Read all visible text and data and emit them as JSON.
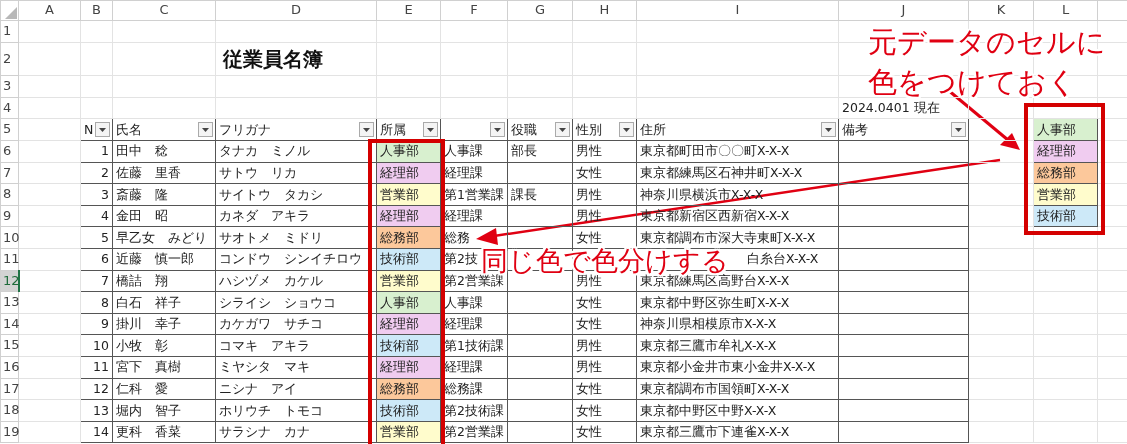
{
  "column_letters": [
    "A",
    "B",
    "C",
    "D",
    "E",
    "F",
    "G",
    "H",
    "I",
    "J",
    "K",
    "L"
  ],
  "row_headers": [
    {
      "label": "1",
      "selected": false
    },
    {
      "label": "2",
      "selected": false
    },
    {
      "label": "3",
      "selected": false
    },
    {
      "label": "4",
      "selected": false
    },
    {
      "label": "5",
      "selected": false
    },
    {
      "label": "6",
      "selected": false
    },
    {
      "label": "7",
      "selected": false
    },
    {
      "label": "8",
      "selected": false
    },
    {
      "label": "9",
      "selected": false
    },
    {
      "label": "10",
      "selected": false
    },
    {
      "label": "11",
      "selected": false
    },
    {
      "label": "12",
      "selected": true
    },
    {
      "label": "13",
      "selected": false
    },
    {
      "label": "14",
      "selected": false
    },
    {
      "label": "15",
      "selected": false
    },
    {
      "label": "16",
      "selected": false
    },
    {
      "label": "17",
      "selected": false
    },
    {
      "label": "18",
      "selected": false
    },
    {
      "label": "19",
      "selected": false
    }
  ],
  "title": "従業員名簿",
  "as_of": "2024.0401 現在",
  "table": {
    "columns": [
      {
        "label": "N"
      },
      {
        "label": "氏名"
      },
      {
        "label": "フリガナ"
      },
      {
        "label": "所属"
      },
      {},
      {
        "label": "役職"
      },
      {
        "label": "性別"
      },
      {
        "label": "住所"
      },
      {
        "label": "備考"
      }
    ],
    "rows": [
      {
        "no": "1",
        "name": "田中　稔",
        "kana": "タナカ　ミノル",
        "dept": "人事部",
        "color": "#d8f0cf",
        "section": "人事課",
        "position": "部長",
        "gender": "男性",
        "address": "東京都町田市〇〇町X-X-X"
      },
      {
        "no": "2",
        "name": "佐藤　里香",
        "kana": "サトウ　リカ",
        "dept": "経理部",
        "color": "#f0ccf0",
        "section": "経理課",
        "gender": "女性",
        "address": "東京都練馬区石神井町X-X-X"
      },
      {
        "no": "3",
        "name": "斎藤　隆",
        "kana": "サイトウ　タカシ",
        "dept": "営業部",
        "color": "#fffccc",
        "section": "第1営業課",
        "position": "課長",
        "gender": "男性",
        "address": "神奈川県横浜市X-X-X"
      },
      {
        "no": "4",
        "name": "金田　昭",
        "kana": "カネダ　アキラ",
        "dept": "経理部",
        "color": "#f0ccf0",
        "section": "経理課",
        "gender": "男性",
        "address": "東京都新宿区西新宿X-X-X"
      },
      {
        "no": "5",
        "name": "早乙女　みどり",
        "kana": "サオトメ　ミドリ",
        "dept": "総務部",
        "color": "#fcc89b",
        "section": "総務",
        "gender": "女性",
        "address": "東京都調布市深大寺東町X-X-X"
      },
      {
        "no": "6",
        "name": "近藤　慎一郎",
        "kana": "コンドウ　シンイチロウ",
        "dept": "技術部",
        "color": "#cde9f8",
        "section": "第2技",
        "address": "白糸台X-X-X"
      },
      {
        "no": "7",
        "name": "橋詰　翔",
        "kana": "ハシヅメ　カケル",
        "dept": "営業部",
        "color": "#fffccc",
        "section": "第2営業課",
        "gender": "男性",
        "address": "東京都練馬区高野台X-X-X"
      },
      {
        "no": "8",
        "name": "白石　祥子",
        "kana": "シライシ　ショウコ",
        "dept": "人事部",
        "color": "#d8f0cf",
        "section": "人事課",
        "gender": "女性",
        "address": "東京都中野区弥生町X-X-X"
      },
      {
        "no": "9",
        "name": "掛川　幸子",
        "kana": "カケガワ　サチコ",
        "dept": "経理部",
        "color": "#f0ccf0",
        "section": "経理課",
        "gender": "女性",
        "address": "神奈川県相模原市X-X-X"
      },
      {
        "no": "10",
        "name": "小牧　彰",
        "kana": "コマキ　アキラ",
        "dept": "技術部",
        "color": "#cde9f8",
        "section": "第1技術課",
        "gender": "男性",
        "address": "東京都三鷹市牟礼X-X-X"
      },
      {
        "no": "11",
        "name": "宮下　真樹",
        "kana": "ミヤシタ　マキ",
        "dept": "経理部",
        "color": "#f0ccf0",
        "section": "経理課",
        "gender": "男性",
        "address": "東京都小金井市東小金井X-X-X"
      },
      {
        "no": "12",
        "name": "仁科　愛",
        "kana": "ニシナ　アイ",
        "dept": "総務部",
        "color": "#fcc89b",
        "section": "総務課",
        "gender": "女性",
        "address": "東京都調布市国領町X-X-X"
      },
      {
        "no": "13",
        "name": "堀内　智子",
        "kana": "ホリウチ　トモコ",
        "dept": "技術部",
        "color": "#cde9f8",
        "section": "第2技術課",
        "gender": "女性",
        "address": "東京都中野区中野X-X-X"
      },
      {
        "no": "14",
        "name": "更科　香菜",
        "kana": "サラシナ　カナ",
        "dept": "営業部",
        "color": "#fffccc",
        "section": "第2営業課",
        "gender": "女性",
        "address": "東京都三鷹市下連雀X-X-X"
      }
    ]
  },
  "legend": [
    {
      "label": "人事部",
      "color": "#d8f0cf"
    },
    {
      "label": "経理部",
      "color": "#f0ccf0"
    },
    {
      "label": "総務部",
      "color": "#fcc89b"
    },
    {
      "label": "営業部",
      "color": "#fffccc"
    },
    {
      "label": "技術部",
      "color": "#cde9f8"
    }
  ],
  "callouts": [
    {
      "lines": [
        "元データのセルに",
        "色をつけておく"
      ]
    },
    {
      "lines": [
        "同じ色で色分けする"
      ]
    }
  ]
}
